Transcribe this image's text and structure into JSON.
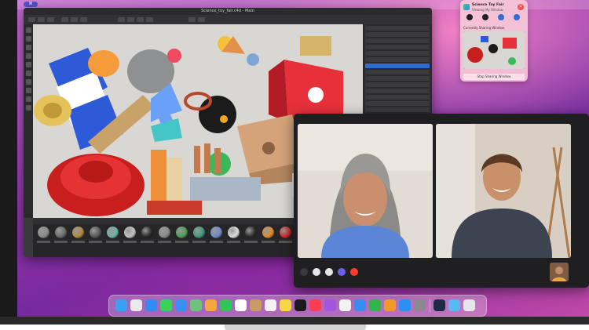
{
  "app": {
    "window_title": "Science_toy_fair.c4d - Main",
    "toolbar_buttons": 12,
    "materials": [
      "Mat",
      "Mat",
      "Mat",
      "Mat",
      "Mat",
      "Mat",
      "Mat",
      "Mat",
      "Mat",
      "Mat",
      "Mat",
      "Mat",
      "Mat",
      "Mat",
      "Mat",
      "Mat",
      "Mat",
      "Mat"
    ],
    "material_colors": [
      "#8b8b8b",
      "#6a6a6a",
      "#b0893a",
      "#5a5a5a",
      "#6fb2a8",
      "#c2c2c2",
      "#2a2a2a",
      "#8a8a8a",
      "#4f9e56",
      "#3f9a7a",
      "#6f88c8",
      "#dcdcdc",
      "#2a2a2a",
      "#e08a2a",
      "#d02a2a",
      "#a02020",
      "#cfcfcf",
      "#e0e0e0"
    ]
  },
  "share_panel": {
    "title": "Science Toy Fair",
    "subtitle": "Viewing My Window",
    "currently_sharing": "Currently Sharing Window",
    "stop_button": "Stop Sharing Window",
    "close_icon": "close-icon"
  },
  "facetime": {
    "controls": [
      "sidebar-icon",
      "mic-icon",
      "camera-icon",
      "screen-share-icon",
      "end-call-icon"
    ],
    "colors": {
      "end_call": "#ff3b30",
      "share": "#6f5ff0"
    }
  },
  "menubar": {
    "pill_label": "⌘"
  },
  "dock": {
    "icons": [
      {
        "name": "finder-icon",
        "color": "#3aa0f5"
      },
      {
        "name": "launchpad-icon",
        "color": "#e9e9ee"
      },
      {
        "name": "safari-icon",
        "color": "#2f8cf3"
      },
      {
        "name": "messages-icon",
        "color": "#3bd15a"
      },
      {
        "name": "mail-icon",
        "color": "#3a8ff5"
      },
      {
        "name": "maps-icon",
        "color": "#6fc27a"
      },
      {
        "name": "photos-icon",
        "color": "#f4a640"
      },
      {
        "name": "facetime-icon",
        "color": "#30c45a"
      },
      {
        "name": "calendar-icon",
        "color": "#ffffff"
      },
      {
        "name": "contacts-icon",
        "color": "#c89a66"
      },
      {
        "name": "reminders-icon",
        "color": "#f2f2f2"
      },
      {
        "name": "notes-icon",
        "color": "#f7d54a"
      },
      {
        "name": "tv-icon",
        "color": "#1b1b1d"
      },
      {
        "name": "music-icon",
        "color": "#fa3d55"
      },
      {
        "name": "podcasts-icon",
        "color": "#a455e0"
      },
      {
        "name": "news-icon",
        "color": "#f2f2f2"
      },
      {
        "name": "keynote-icon",
        "color": "#3a8bf1"
      },
      {
        "name": "numbers-icon",
        "color": "#35b24a"
      },
      {
        "name": "pages-icon",
        "color": "#f19a2a"
      },
      {
        "name": "app-store-icon",
        "color": "#2d8ef3"
      },
      {
        "name": "system-preferences-icon",
        "color": "#8a8a8e"
      },
      {
        "name": "cinema4d-icon",
        "color": "#1f2a44"
      },
      {
        "name": "downloads-folder-icon",
        "color": "#5ab8f2"
      },
      {
        "name": "trash-icon",
        "color": "#e6e6ea"
      }
    ]
  }
}
